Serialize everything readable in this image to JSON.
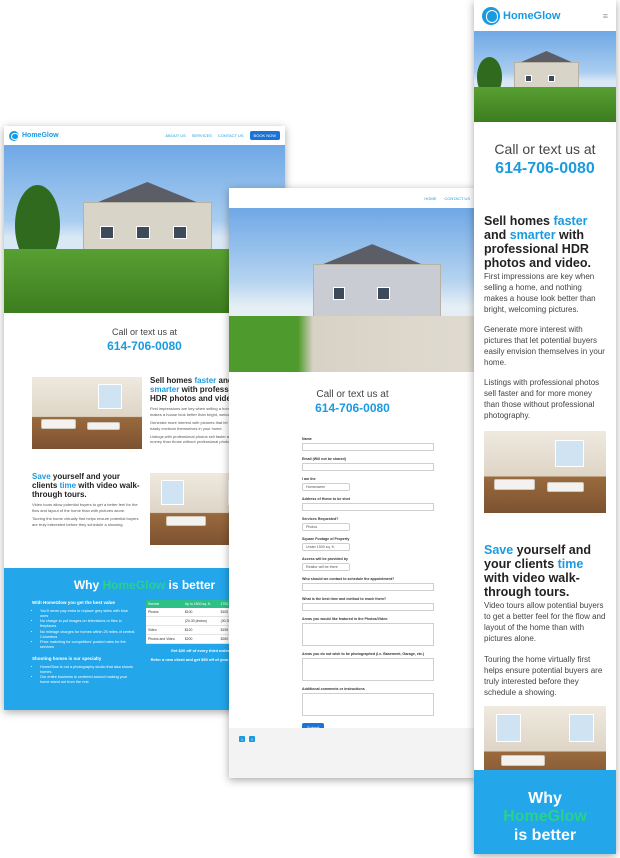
{
  "brand": {
    "name": "HomeGlow",
    "accent": "#1a9be0",
    "green": "#27d28a",
    "why_bg": "#23a6ea"
  },
  "nav": {
    "about": "ABOUT US",
    "services": "SERVICES",
    "contact": "CONTACT US",
    "book": "BOOK NOW",
    "home": "HOME"
  },
  "call": {
    "line1": "Call or text us at",
    "phone": "614-706-0080"
  },
  "sell": {
    "pre": "Sell homes ",
    "faster": "faster",
    "mid": " and ",
    "smarter": "smarter",
    "post": " with professional HDR photos and video.",
    "p1": "First impressions are key when selling a home, and nothing makes a house look better than bright, welcoming pictures.",
    "p2": "Generate more interest with pictures that let potential buyers easily envision themselves in your home.",
    "p3": "Listings with professional photos sell faster and for more money than those without professional photography."
  },
  "save": {
    "save": "Save",
    "mid": " yourself and your clients ",
    "time": "time",
    "post": " with video walk-through tours.",
    "p1": "Video tours allow potential buyers to get a better feel for the flow and layout of the home than with pictures alone.",
    "p2": "Touring the home virtually first helps ensure potential buyers are truly interested before they schedule a showing."
  },
  "why": {
    "pre": "Why ",
    "brand": "HomeGlow",
    "post": " is better",
    "best_value": "With HomeGlow you get the best value",
    "bullets": [
      "You'll never pay extra to replace grey skies with blue ones",
      "No charge to put images on televisions or files in fireplaces",
      "No mileage charges for homes within 25 miles of central Columbus",
      "Price matching for competitors' posted rates for the services"
    ],
    "specialty": "Shooting homes is our specialty",
    "bullets2": [
      "HomeGlow is not a photography studio that also shoots homes",
      "Our entire business is centered around making your home stand out from the rest"
    ],
    "table": {
      "headers": [
        "Service",
        "Up to 1500 sq. ft.",
        "1750-3000 sq. ft."
      ],
      "rows": [
        [
          "Photos",
          "$100",
          "$100"
        ],
        [
          "",
          "(20-30 photos)",
          "(30-35 photos)"
        ],
        [
          "Video",
          "$120",
          "$195"
        ],
        [
          "Photos and Video",
          "$200",
          "$260"
        ]
      ]
    },
    "deal1": "Get $20 off of every third order",
    "deal2": "Refer a new client and get $50 off of your next order"
  },
  "form": {
    "name": "Name",
    "email": "Email (Will not be shared)",
    "i_am": "I am the",
    "i_am_value": "Homeowner",
    "address": "Address of Home to be shot",
    "services": "Services Requested?",
    "services_value": "Photos",
    "sqft": "Square Footage of Property",
    "sqft_value": "Under 1500 sq. ft.",
    "access": "Access will be provided by",
    "access_value": "Realtor will be there",
    "contact": "Who should we contact to schedule the appointment?",
    "best_time": "What is the best time and method to reach them?",
    "featured": "Areas you would like featured in the Photos/Video",
    "not_photographed": "Areas you do not wish to be photographed (i.e. Basement, Garage, etc.)",
    "comments": "Additional comments or instructions",
    "submit": "Submit"
  },
  "icons": {
    "menu": "hamburger-menu-icon",
    "twitter": "twitter-icon",
    "facebook": "facebook-icon"
  }
}
